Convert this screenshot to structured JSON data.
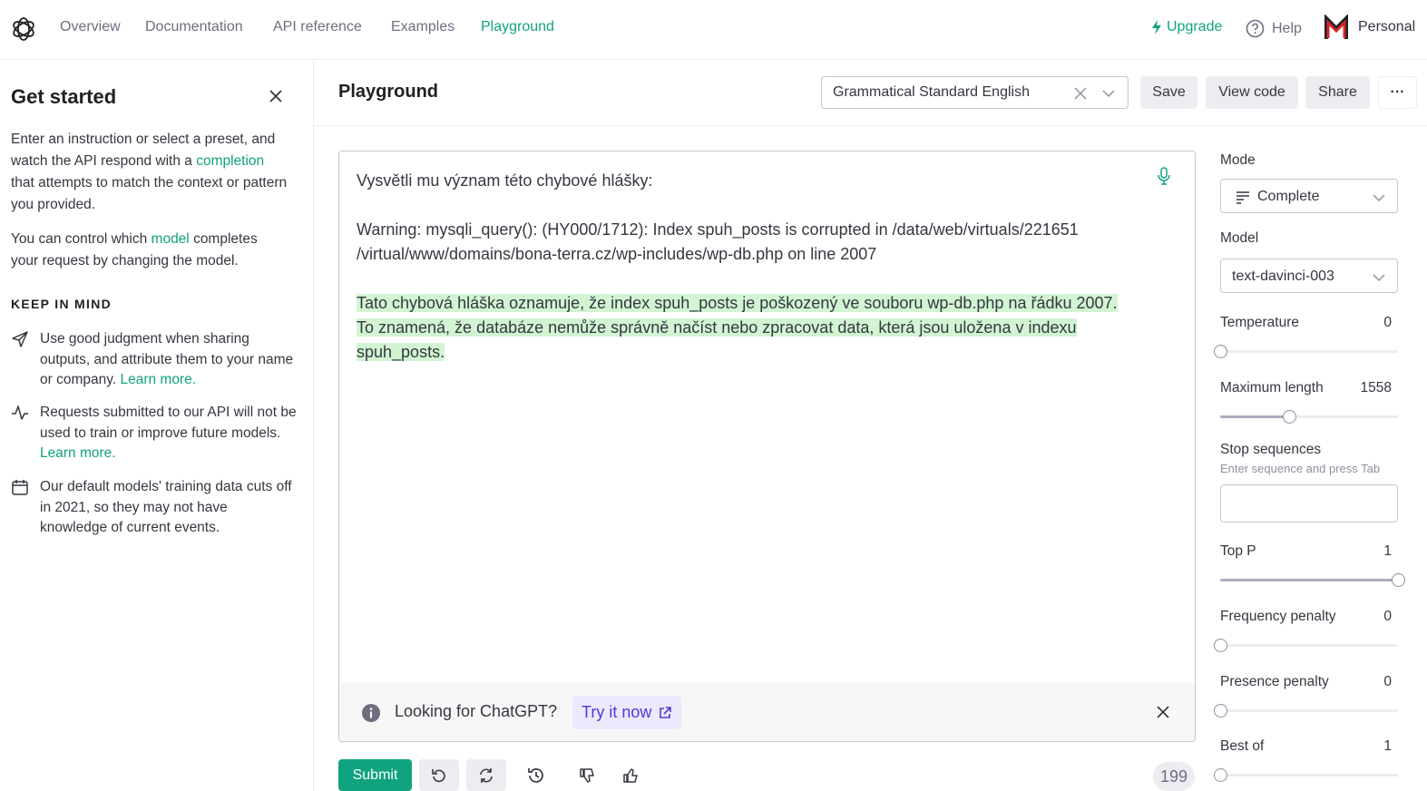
{
  "nav": {
    "links": [
      "Overview",
      "Documentation",
      "API reference",
      "Examples",
      "Playground"
    ],
    "upgrade": "Upgrade",
    "help": "Help",
    "account": "Personal",
    "accent": "#10a37f"
  },
  "sidebar": {
    "title": "Get started",
    "intro_1": "Enter an instruction or select a preset, and watch the API respond with a",
    "intro_link": "completion",
    "intro_2": "that attempts to match the context or pattern you provided.",
    "model_1": "You can control which",
    "model_link": "model",
    "model_2": "completes your request by changing the model.",
    "keep_in_mind": "KEEP IN MIND",
    "tips": [
      {
        "icon": "send-icon",
        "text": "Use good judgment when sharing outputs, and attribute them to your name or company.",
        "link": "Learn more."
      },
      {
        "icon": "activity-icon",
        "text": "Requests submitted to our API will not be used to train or improve future models.",
        "link": "Learn more."
      },
      {
        "icon": "calendar-icon",
        "text": "Our default models' training data cuts off in 2021, so they may not have knowledge of current events.",
        "link": ""
      }
    ]
  },
  "header": {
    "title": "Playground",
    "preset": "Grammatical Standard English",
    "save": "Save",
    "view_code": "View code",
    "share": "Share",
    "more": "···"
  },
  "editor": {
    "prompt_line1": "Vysvětli mu význam této chybové hlášky:",
    "warning_line1": "Warning: mysqli_query(): (HY000/1712): Index spuh_posts is corrupted in /data/web/virtuals/221651",
    "warning_line2": "/virtual/www/domains/bona-terra.cz/wp-includes/wp-db.php on line 2007",
    "completion_line1": "Tato chybová hláška oznamuje, že index spuh_posts je poškozený ve souboru wp-db.php na řádku 2007.",
    "completion_line2": "To znamená, že databáze nemůže správně načíst nebo zpracovat data, která jsou uložena v indexu",
    "completion_line3": "spuh_posts.",
    "highlight_color": "#d2f4d3"
  },
  "banner": {
    "question": "Looking for ChatGPT?",
    "cta": "Try it now"
  },
  "bottom": {
    "submit": "Submit",
    "token_count": "199"
  },
  "settings": {
    "mode_label": "Mode",
    "mode_value": "Complete",
    "model_label": "Model",
    "model_value": "text-davinci-003",
    "temperature_label": "Temperature",
    "temperature_value": "0",
    "max_length_label": "Maximum length",
    "max_length_value": "1558",
    "stop_label": "Stop sequences",
    "stop_hint": "Enter sequence and press Tab",
    "top_p_label": "Top P",
    "top_p_value": "1",
    "freq_label": "Frequency penalty",
    "freq_value": "0",
    "presence_label": "Presence penalty",
    "presence_value": "0",
    "best_of_label": "Best of",
    "best_of_value": "1",
    "slider_levels": {
      "temperature": 0,
      "max_length": 0.39,
      "top_p": 1,
      "frequency_penalty": 0,
      "presence_penalty": 0,
      "best_of": 0
    }
  }
}
